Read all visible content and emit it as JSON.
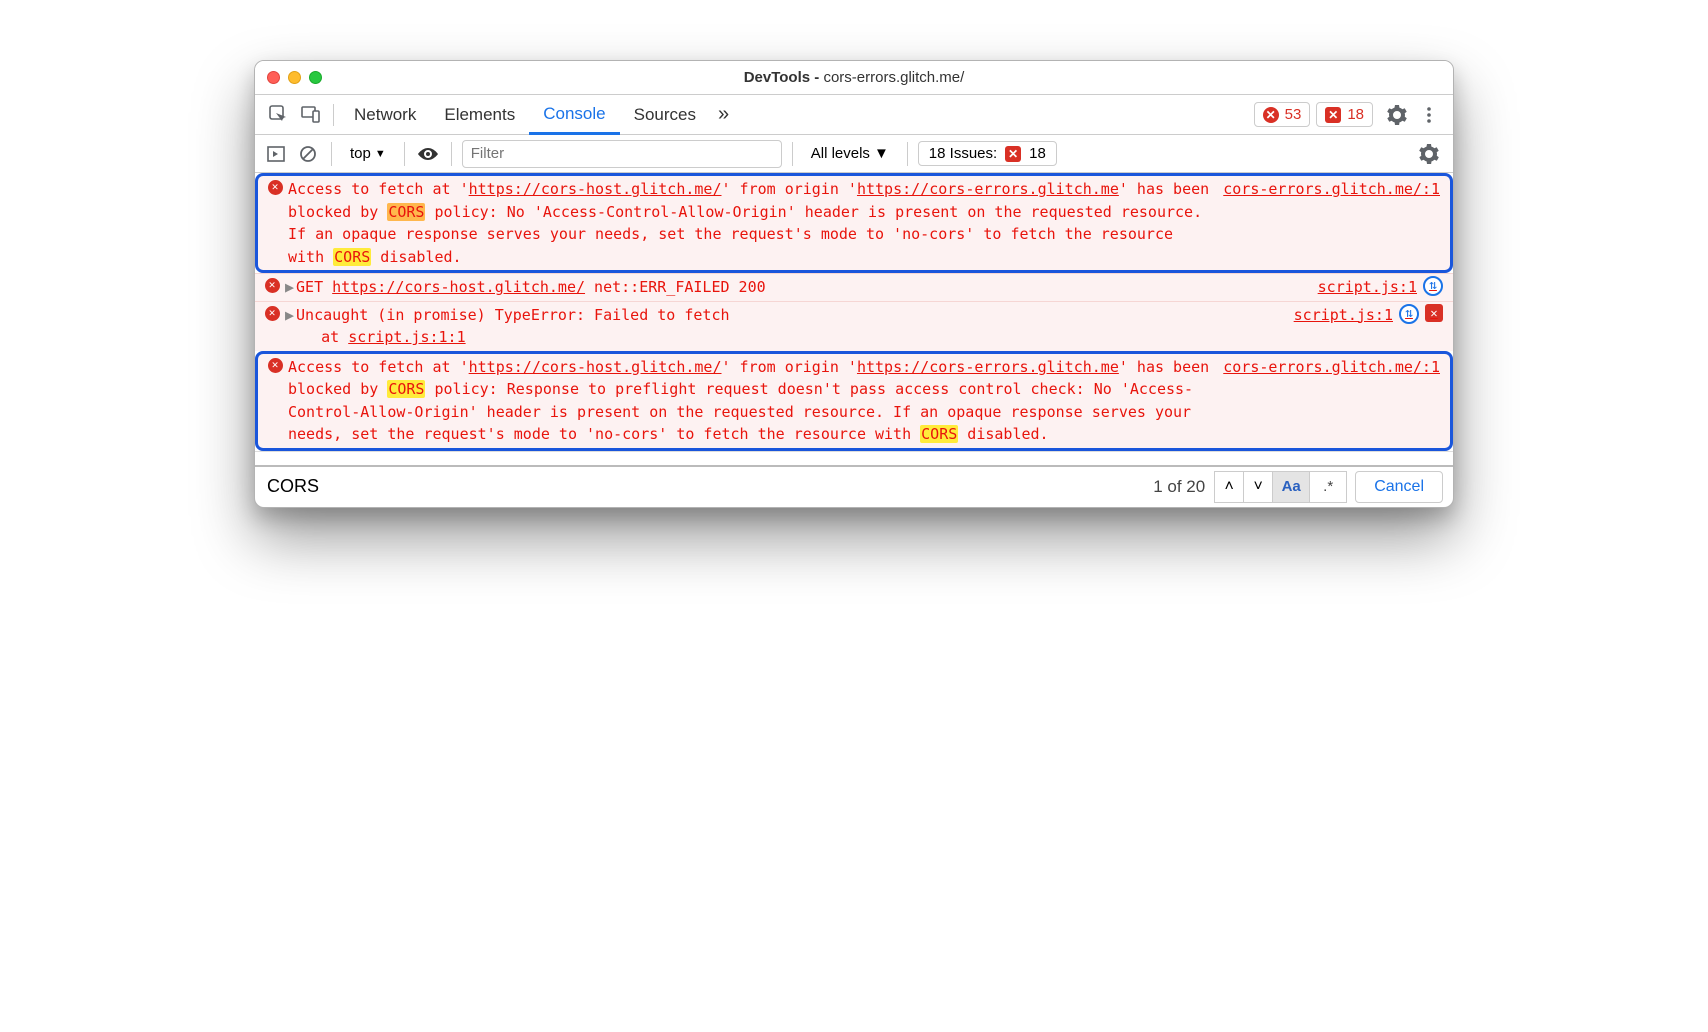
{
  "window": {
    "title_prefix": "DevTools - ",
    "title_url": "cors-errors.glitch.me/"
  },
  "tabs": {
    "items": [
      "Network",
      "Elements",
      "Console",
      "Sources"
    ],
    "active_index": 2,
    "overflow_glyph": "»",
    "error_count": "53",
    "issue_count": "18"
  },
  "toolbar": {
    "context": "top",
    "filter_placeholder": "Filter",
    "levels": "All levels",
    "issues_label": "18 Issues:",
    "issues_count": "18"
  },
  "messages": [
    {
      "type": "cors",
      "highlighted": true,
      "hl_class": "hl-o",
      "text1a": "Access to fetch at '",
      "url1": "https://cors-host.glitch.me/",
      "text1b": "' from origin '",
      "url2": "https://cors-errors.glitch.me",
      "text1c": "' has been blocked by ",
      "cors": "CORS",
      "tail": " policy: No 'Access-Control-Allow-Origin' header is present on the requested resource. If an opaque response serves your needs, set the request's mode to 'no-cors' to fetch the resource with ",
      "cors2": "CORS",
      "tail2": " disabled.",
      "source": "cors-errors.glitch.me/:1"
    },
    {
      "type": "net",
      "pre": "GET ",
      "url": "https://cors-host.glitch.me/",
      "post": " net::ERR_FAILED 200",
      "source": "script.js:1",
      "nav": true
    },
    {
      "type": "exc",
      "line1": "Uncaught (in promise) TypeError: Failed to fetch",
      "line2pre": "    at ",
      "line2u": "script.js:1:1",
      "source": "script.js:1",
      "nav": true,
      "badge": true
    },
    {
      "type": "cors",
      "highlighted": true,
      "hl_class": "hl",
      "text1a": "Access to fetch at '",
      "url1": "https://cors-host.glitch.me/",
      "text1b": "' from origin '",
      "url2": "https://cors-errors.glitch.me",
      "text1c": "' has been blocked by ",
      "cors": "CORS",
      "tail": " policy: Response to preflight request doesn't pass access control check: No 'Access-Control-Allow-Origin' header is present on the requested resource. If an opaque response serves your needs, set the request's mode to 'no-cors' to fetch the resource with ",
      "cors2": "CORS",
      "tail2": " disabled.",
      "source": "cors-errors.glitch.me/:1"
    }
  ],
  "search": {
    "value": "CORS",
    "count": "1 of 20",
    "case_label": "Aa",
    "regex_label": ".*",
    "cancel": "Cancel"
  }
}
